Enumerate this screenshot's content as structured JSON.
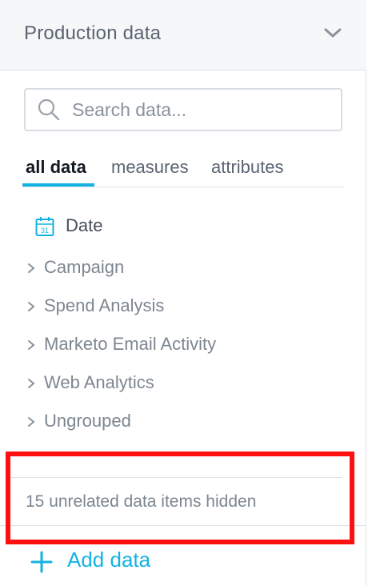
{
  "header": {
    "title": "Production data",
    "collapse_icon": "chevron-down-icon"
  },
  "search": {
    "placeholder": "Search data...",
    "value": ""
  },
  "tabs": [
    {
      "label": "all data",
      "active": true
    },
    {
      "label": "measures",
      "active": false
    },
    {
      "label": "attributes",
      "active": false
    }
  ],
  "date_item": {
    "label": "Date",
    "icon": "calendar-icon",
    "icon_text": "31"
  },
  "groups": [
    {
      "label": "Campaign"
    },
    {
      "label": "Spend Analysis"
    },
    {
      "label": "Marketo Email Activity"
    },
    {
      "label": "Web Analytics"
    },
    {
      "label": "Ungrouped"
    }
  ],
  "footer": {
    "hidden_text": "15 unrelated data items hidden"
  },
  "add_data": {
    "label": "Add data",
    "icon": "plus-icon"
  },
  "colors": {
    "accent": "#14b2e2",
    "highlight": "#ff1010",
    "text": "#464e56",
    "muted": "#7d8690"
  }
}
